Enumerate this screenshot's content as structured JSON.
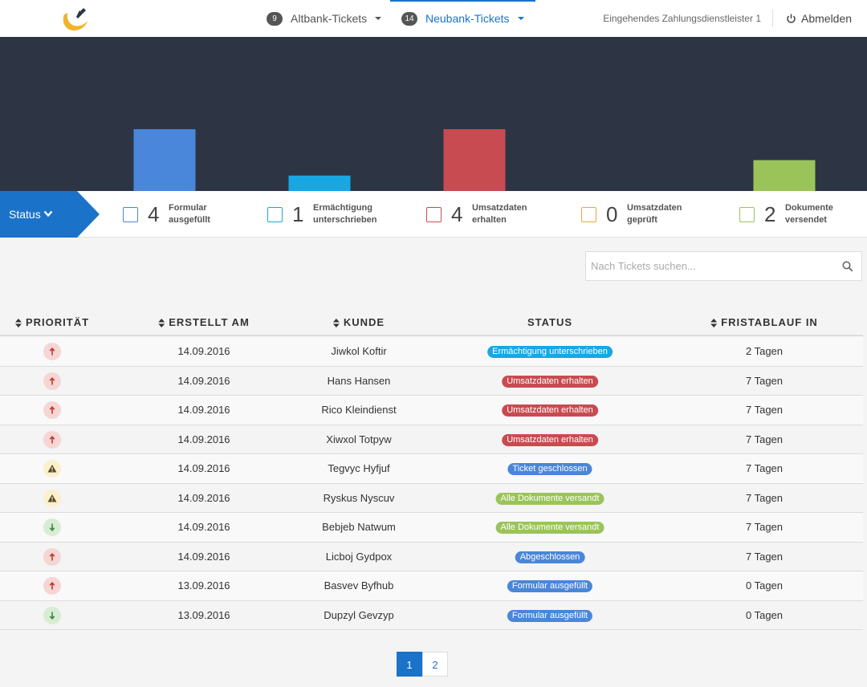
{
  "nav": {
    "tabs": [
      {
        "count": "9",
        "label": "Altbank-Tickets"
      },
      {
        "count": "14",
        "label": "Neubank-Tickets"
      }
    ],
    "provider": "Eingehendes Zahlungsdienstleister 1",
    "logout": "Abmelden"
  },
  "colors": {
    "primary": "#1a73c8",
    "chart_bg": "#2d3545",
    "formular": "#4a86d9",
    "ermaechtigung": "#17a8e3",
    "umsatz_erhalten": "#c74b50",
    "umsatz_geprueft": "#e8a93a",
    "dokumente": "#9ac45a"
  },
  "status_filter": {
    "label": "Status",
    "items": [
      {
        "count": "4",
        "line1": "Formular",
        "line2": "ausgefüllt",
        "color": "#4a86d9"
      },
      {
        "count": "1",
        "line1": "Ermächtigung",
        "line2": "unterschrieben",
        "color": "#17a8e3"
      },
      {
        "count": "4",
        "line1": "Umsatzdaten",
        "line2": "erhalten",
        "color": "#c74b50"
      },
      {
        "count": "0",
        "line1": "Umsatzdaten",
        "line2": "geprüft",
        "color": "#e8a93a"
      },
      {
        "count": "2",
        "line1": "Dokumente",
        "line2": "versendet",
        "color": "#9ac45a"
      }
    ]
  },
  "chart_data": {
    "type": "bar",
    "categories": [
      "Formular ausgefüllt",
      "Ermächtigung unterschrieben",
      "Umsatzdaten erhalten",
      "Umsatzdaten geprüft",
      "Dokumente versendet"
    ],
    "values": [
      4,
      1,
      4,
      0,
      2
    ],
    "colors": [
      "#4a86d9",
      "#17a8e3",
      "#c74b50",
      "#e8a93a",
      "#9ac45a"
    ],
    "ylim": [
      0,
      4
    ],
    "grid": false,
    "legend": "none"
  },
  "search": {
    "placeholder": "Nach Tickets suchen..."
  },
  "table": {
    "headers": {
      "prioritaet": "PRIORITÄT",
      "erstellt": "ERSTELLT AM",
      "kunde": "KUNDE",
      "status": "STATUS",
      "frist": "FRISTABLAUF IN"
    },
    "rows": [
      {
        "priority": "high",
        "date": "14.09.2016",
        "customer": "Jiwkol Koftir",
        "status": "Ermächtigung unterschrieben",
        "status_color": "#17a8e3",
        "deadline": "2 Tagen"
      },
      {
        "priority": "high",
        "date": "14.09.2016",
        "customer": "Hans Hansen",
        "status": "Umsatzdaten erhalten",
        "status_color": "#c74b50",
        "deadline": "7 Tagen"
      },
      {
        "priority": "high",
        "date": "14.09.2016",
        "customer": "Rico Kleindienst",
        "status": "Umsatzdaten erhalten",
        "status_color": "#c74b50",
        "deadline": "7 Tagen"
      },
      {
        "priority": "high",
        "date": "14.09.2016",
        "customer": "Xiwxol Totpyw",
        "status": "Umsatzdaten erhalten",
        "status_color": "#c74b50",
        "deadline": "7 Tagen"
      },
      {
        "priority": "warning",
        "date": "14.09.2016",
        "customer": "Tegvyc Hyfjuf",
        "status": "Ticket geschlossen",
        "status_color": "#4a86d9",
        "deadline": "7 Tagen"
      },
      {
        "priority": "warning",
        "date": "14.09.2016",
        "customer": "Ryskus Nyscuv",
        "status": "Alle Dokumente versandt",
        "status_color": "#9ac45a",
        "deadline": "7 Tagen"
      },
      {
        "priority": "low",
        "date": "14.09.2016",
        "customer": "Bebjeb Natwum",
        "status": "Alle Dokumente versandt",
        "status_color": "#9ac45a",
        "deadline": "7 Tagen"
      },
      {
        "priority": "high",
        "date": "14.09.2016",
        "customer": "Licboj Gydpox",
        "status": "Abgeschlossen",
        "status_color": "#4a86d9",
        "deadline": "7 Tagen"
      },
      {
        "priority": "high",
        "date": "13.09.2016",
        "customer": "Basvev Byfhub",
        "status": "Formular ausgefüllt",
        "status_color": "#4a86d9",
        "deadline": "0 Tagen"
      },
      {
        "priority": "low",
        "date": "13.09.2016",
        "customer": "Dupzyl Gevzyp",
        "status": "Formular ausgefüllt",
        "status_color": "#4a86d9",
        "deadline": "0 Tagen"
      }
    ]
  },
  "pagination": {
    "pages": [
      "1",
      "2"
    ],
    "current": "1"
  }
}
